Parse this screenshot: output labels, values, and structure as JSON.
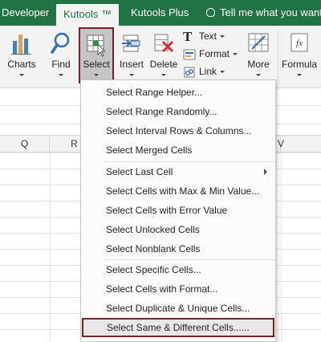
{
  "tabs": {
    "developer": "Developer",
    "kutools": "Kutools ™",
    "kutools_plus": "Kutools Plus",
    "tell_me": "Tell me what you want t"
  },
  "ribbon": {
    "charts": "Charts",
    "find": "Find",
    "select": "Select",
    "insert": "Insert",
    "delete": "Delete",
    "text": "Text",
    "format": "Format",
    "link": "Link",
    "more": "More",
    "formula": "Formula"
  },
  "columns": [
    "Q",
    "R",
    "V"
  ],
  "menu": {
    "group1": [
      "Select Range Helper...",
      "Select Range Randomly...",
      "Select Interval Rows & Columns...",
      "Select Merged Cells"
    ],
    "group2": [
      "Select Last Cell",
      "Select Cells with Max & Min Value...",
      "Select Cells with Error Value",
      "Select Unlocked Cells",
      "Select Nonblank Cells"
    ],
    "group3": [
      "Select Specific Cells...",
      "Select Cells with Format...",
      "Select Duplicate & Unique Cells...",
      "Select Same & Different Cells......"
    ]
  },
  "colors": {
    "tab_green": "#217346",
    "highlight_border": "#7a1f24"
  }
}
